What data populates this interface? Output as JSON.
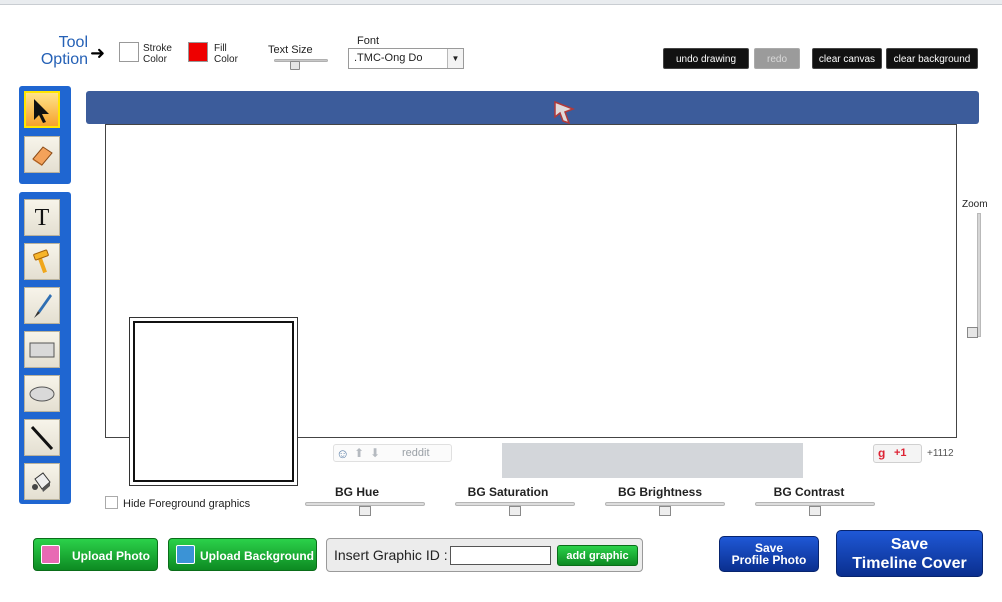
{
  "header": {
    "tool_option_line1": "Tool",
    "tool_option_line2": "Option",
    "stroke_line1": "Stroke",
    "stroke_line2": "Color",
    "fill_line1": "Fill",
    "fill_line2": "Color",
    "stroke_color": "#ffffff",
    "fill_color": "#ee0000",
    "text_size_label": "Text Size",
    "font_label": "Font",
    "font_value": ".TMC-Ong Do"
  },
  "actions": {
    "undo": "undo drawing",
    "redo": "redo",
    "clear_canvas": "clear canvas",
    "clear_background": "clear background"
  },
  "tools": {
    "select": "select-arrow-icon",
    "eraser": "eraser-icon",
    "text": "T",
    "hammer": "hammer-icon",
    "brush": "brush-icon",
    "rectangle": "rectangle-icon",
    "ellipse": "ellipse-icon",
    "line": "line-icon",
    "fill": "paint-bucket-icon"
  },
  "canvas": {
    "banner_color": "#3c5c9b",
    "zoom_label": "Zoom"
  },
  "social": {
    "reddit": "reddit",
    "gplus": "+1",
    "gplus_count": "+1112"
  },
  "bg_controls": {
    "hue": "BG Hue",
    "saturation": "BG Saturation",
    "brightness": "BG Brightness",
    "contrast": "BG Contrast"
  },
  "hide_foreground_label": "Hide Foreground graphics",
  "bottom": {
    "upload_photo": "Upload  Photo",
    "upload_background": "Upload Background",
    "insert_graphic_label": "Insert Graphic ID :",
    "insert_graphic_value": "",
    "add_graphic": "add graphic",
    "save_profile_line1": "Save",
    "save_profile_line2": "Profile Photo",
    "save_cover_line1": "Save",
    "save_cover_line2": "Timeline Cover"
  }
}
